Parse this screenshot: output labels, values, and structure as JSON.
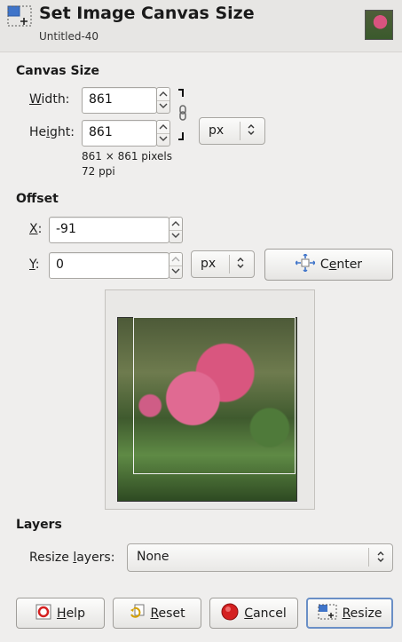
{
  "dialog": {
    "title": "Set Image Canvas Size",
    "subtitle": "Untitled-40",
    "thumbnail_icon": "flower-thumbnail"
  },
  "canvas_size": {
    "heading": "Canvas Size",
    "width_label": "Width:",
    "width_value": "861",
    "height_label": "Height:",
    "height_value": "861",
    "unit": "px",
    "chain_icon": "chain-link-icon",
    "info_pixels": "861 × 861 pixels",
    "info_ppi": "72 ppi"
  },
  "offset": {
    "heading": "Offset",
    "x_label": "X:",
    "x_value": "-91",
    "y_label": "Y:",
    "y_value": "0",
    "unit": "px",
    "center_label": "Center"
  },
  "layers": {
    "heading": "Layers",
    "resize_label": "Resize layers:",
    "resize_value": "None"
  },
  "buttons": {
    "help": "Help",
    "reset": "Reset",
    "cancel": "Cancel",
    "resize": "Resize"
  },
  "colors": {
    "accent": "#6a8fc6",
    "cancel_red": "#d42020"
  }
}
